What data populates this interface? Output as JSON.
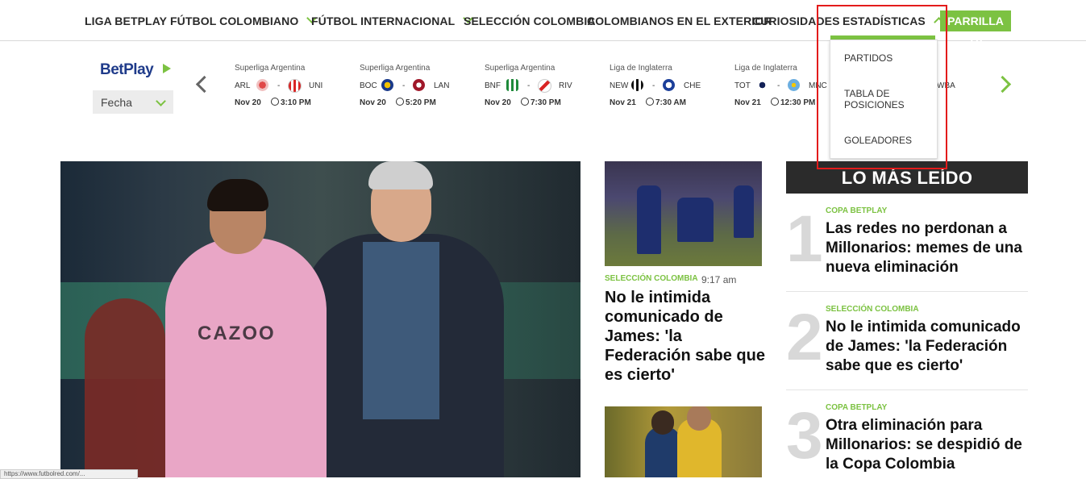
{
  "nav": {
    "items": [
      {
        "label": "LIGA BETPLAY"
      },
      {
        "label": "FÚTBOL COLOMBIANO"
      },
      {
        "label": "FÚTBOL INTERNACIONAL"
      },
      {
        "label": "SELECCIÓN COLOMBIA"
      },
      {
        "label": "COLOMBIANOS EN EL EXTERIOR"
      },
      {
        "label": "CURIOSIDADES"
      },
      {
        "label": "ESTADÍSTICAS"
      }
    ],
    "parrilla_label": "PARRILLA TV",
    "dropdown": [
      "PARTIDOS",
      "TABLA DE POSICIONES",
      "GOLEADORES"
    ]
  },
  "brand": {
    "logo_text_bet": "Bet",
    "logo_text_play": "Play",
    "accent": "#7cc242",
    "dark": "#2b2b2b"
  },
  "fecha_label": "Fecha",
  "matches": [
    {
      "league": "Superliga Argentina",
      "home": "ARL",
      "away": "UNI",
      "date": "Nov 20",
      "time": "3:10 PM"
    },
    {
      "league": "Superliga Argentina",
      "home": "BOC",
      "away": "LAN",
      "date": "Nov 20",
      "time": "5:20 PM"
    },
    {
      "league": "Superliga Argentina",
      "home": "BNF",
      "away": "RIV",
      "date": "Nov 20",
      "time": "7:30 PM"
    },
    {
      "league": "Liga de Inglaterra",
      "home": "NEW",
      "away": "CHE",
      "date": "Nov 21",
      "time": "7:30 AM"
    },
    {
      "league": "Liga de Inglaterra",
      "home": "TOT",
      "away": "MNC",
      "date": "Nov 21",
      "time": "12:30 PM"
    }
  ],
  "partial_match_team": "WBA",
  "hero": {
    "shirt_text": "CAZOO"
  },
  "mid_article": {
    "category": "SELECCIÓN COLOMBIA",
    "time": "9:17 am",
    "title": "No le intimida comunicado de James: 'la Federación sabe que es cierto'"
  },
  "most_read": {
    "heading": "LO MÁS LEÍDO",
    "items": [
      {
        "num": "1",
        "category": "COPA BETPLAY",
        "title": "Las redes no perdonan a Millonarios: memes de una nueva eliminación"
      },
      {
        "num": "2",
        "category": "SELECCIÓN COLOMBIA",
        "title": "No le intimida comunicado de James: 'la Federación sabe que es cierto'"
      },
      {
        "num": "3",
        "category": "COPA BETPLAY",
        "title": "Otra eliminación para Millonarios: se despidió de la Copa Colombia"
      }
    ]
  },
  "status_url": "https://www.futbolred.com/..."
}
